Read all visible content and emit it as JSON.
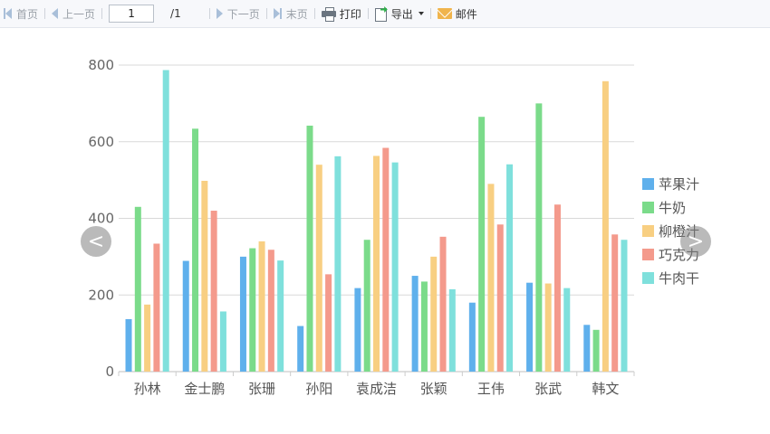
{
  "toolbar": {
    "first": "首页",
    "prev": "上一页",
    "page_value": "1",
    "page_total": "/1",
    "next": "下一页",
    "last": "末页",
    "print": "打印",
    "export": "导出",
    "mail": "邮件"
  },
  "nav": {
    "left": "<",
    "right": ">"
  },
  "chart_data": {
    "type": "bar",
    "categories": [
      "孙林",
      "金士鹏",
      "张珊",
      "孙阳",
      "袁成洁",
      "张颖",
      "王伟",
      "张武",
      "韩文"
    ],
    "series": [
      {
        "name": "苹果汁",
        "color": "#5fb0ec",
        "values": [
          137,
          289,
          300,
          119,
          218,
          250,
          180,
          232,
          122
        ]
      },
      {
        "name": "牛奶",
        "color": "#7bdb8a",
        "values": [
          430,
          634,
          322,
          642,
          344,
          235,
          665,
          700,
          109
        ]
      },
      {
        "name": "柳橙汁",
        "color": "#f8cf82",
        "values": [
          175,
          498,
          340,
          540,
          563,
          300,
          490,
          230,
          758
        ]
      },
      {
        "name": "巧克力",
        "color": "#f49a8c",
        "values": [
          334,
          420,
          318,
          254,
          584,
          352,
          384,
          436,
          358
        ]
      },
      {
        "name": "牛肉干",
        "color": "#7fe0dc",
        "values": [
          787,
          157,
          290,
          562,
          546,
          215,
          541,
          218,
          344
        ]
      }
    ],
    "yticks": [
      "0",
      "200",
      "400",
      "600",
      "800"
    ],
    "ylim": [
      0,
      800
    ],
    "grid": true,
    "legend": "right"
  }
}
